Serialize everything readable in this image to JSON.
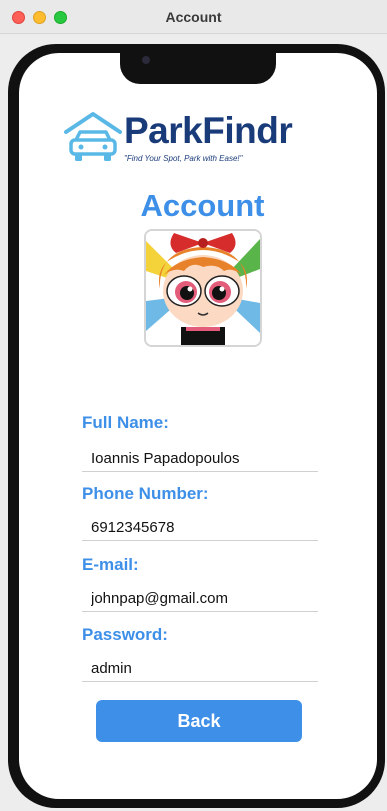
{
  "window": {
    "title": "Account"
  },
  "brand": {
    "name": "ParkFindr",
    "tagline": "\"Find Your Spot, Park with Ease!\""
  },
  "page": {
    "title": "Account"
  },
  "avatar": {
    "icon": "profile-picture"
  },
  "fields": {
    "full_name": {
      "label": "Full Name:",
      "value": "Ioannis Papadopoulos"
    },
    "phone": {
      "label": "Phone Number:",
      "value": "6912345678"
    },
    "email": {
      "label": "E-mail:",
      "value": "johnpap@gmail.com"
    },
    "password": {
      "label": "Password:",
      "value": "admin"
    }
  },
  "back_button": {
    "label": "Back"
  },
  "colors": {
    "accent": "#3d8fe8",
    "brand_dark": "#1a3b7a",
    "brand_light": "#5ab8e6"
  }
}
